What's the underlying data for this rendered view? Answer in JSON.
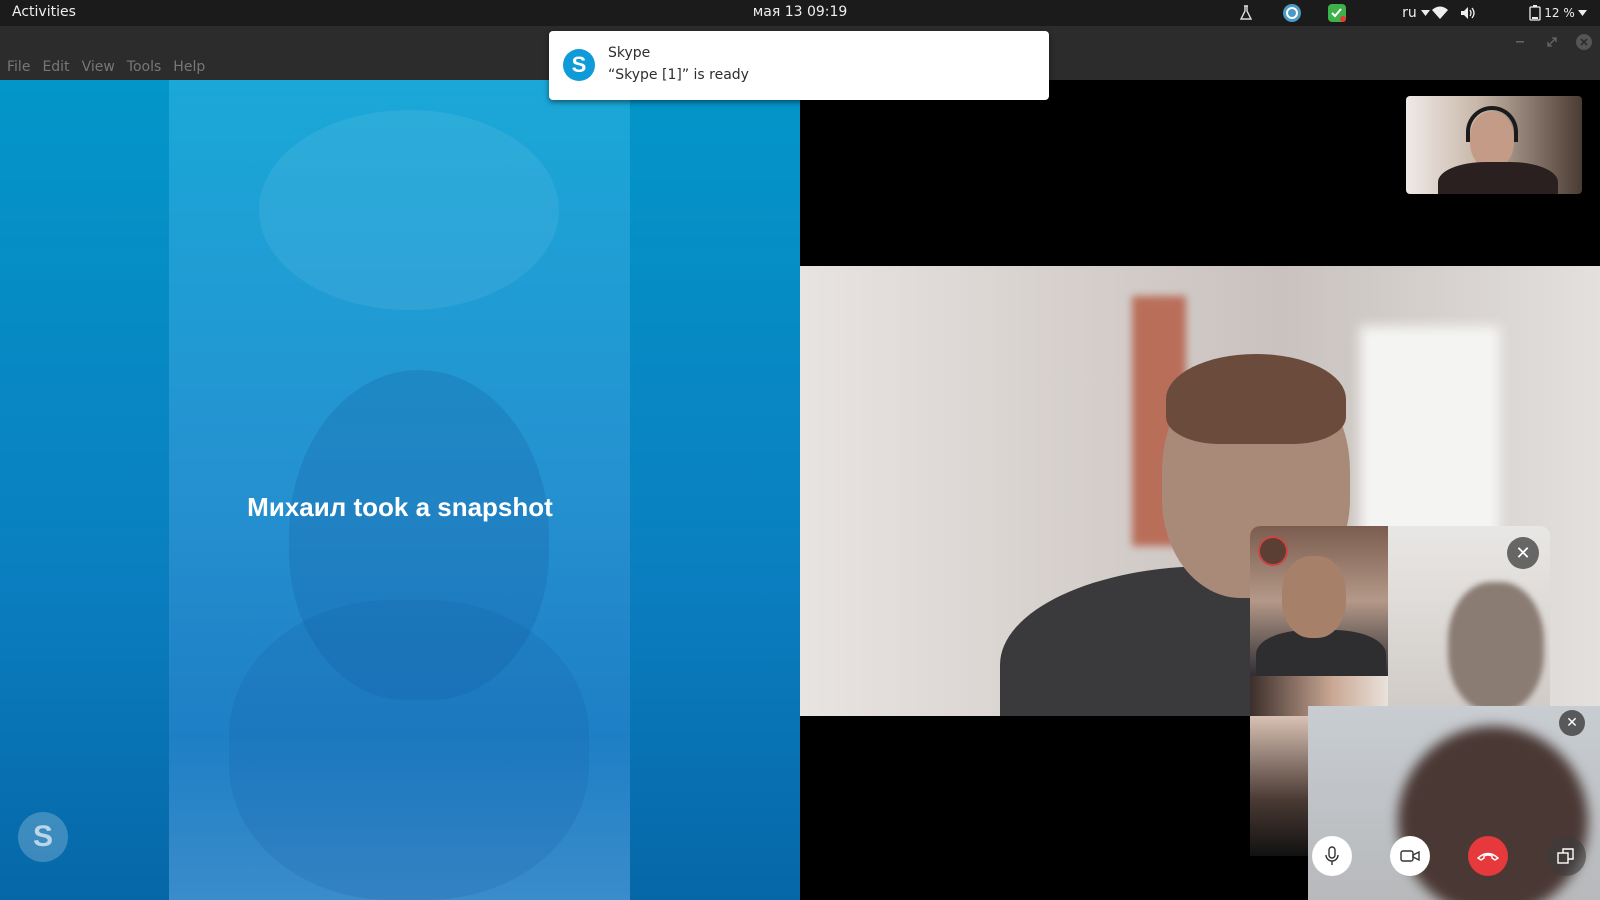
{
  "topbar": {
    "activities_label": "Activities",
    "clock": "мая 13  09:19",
    "language": "ru",
    "battery": "12 %",
    "icons": [
      "flask-icon",
      "skype-tray-icon",
      "check-shield-icon",
      "wifi-icon",
      "volume-icon",
      "battery-icon"
    ]
  },
  "window": {
    "menu": [
      "File",
      "Edit",
      "View",
      "Tools",
      "Help"
    ],
    "controls": [
      "minimize-icon",
      "maximize-icon",
      "close-icon"
    ]
  },
  "left_panel": {
    "snapshot_text": "Михаил took a snapshot",
    "watermark_letter": "S"
  },
  "notification": {
    "app_name": "Skype",
    "message": "“Skype [1]” is ready",
    "icon_letter": "S"
  },
  "call_controls": {
    "close_symbol": "✕",
    "buttons": [
      "microphone-icon",
      "video-camera-icon",
      "hang-up-icon",
      "pop-out-icon"
    ]
  },
  "colors": {
    "skype_blue": "#0f9ad8",
    "hangup_red": "#e5393b",
    "topbar_bg": "#1b1b1b"
  }
}
